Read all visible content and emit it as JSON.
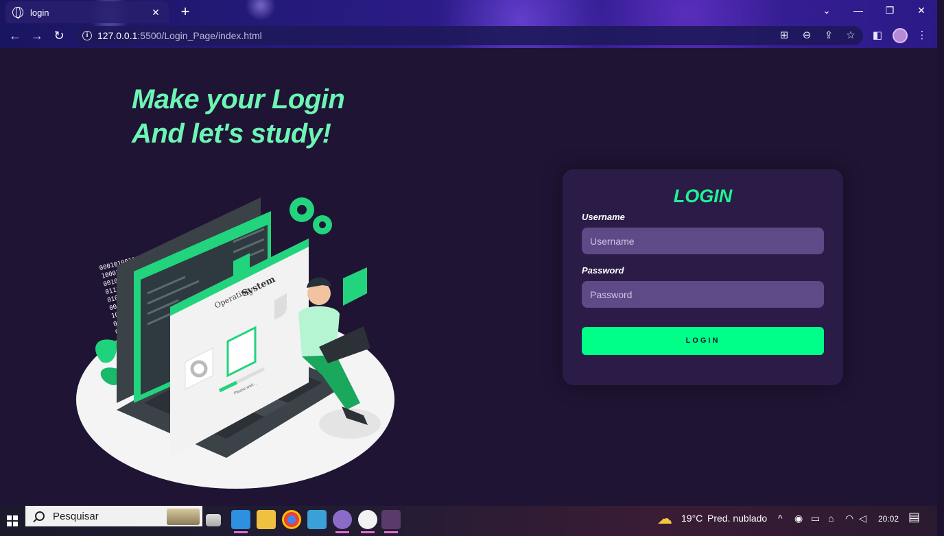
{
  "browser": {
    "tab_title": "login",
    "url_host": "127.0.0.1",
    "url_path": ":5500/Login_Page/index.html"
  },
  "page": {
    "hero_line1": "Make your Login",
    "hero_line2": "And let's study!",
    "illustration": {
      "screen_title_small": "Operating",
      "screen_title_big": "System",
      "progress_text": "Please wait..."
    },
    "login": {
      "title": "LOGIN",
      "username_label": "Username",
      "username_placeholder": "Username",
      "password_label": "Password",
      "password_placeholder": "Password",
      "button_label": "LOGIN"
    }
  },
  "taskbar": {
    "search_placeholder": "Pesquisar",
    "weather_temp": "19°C",
    "weather_desc": "Pred. nublado",
    "time": "20:02"
  },
  "colors": {
    "accent": "#00ff88",
    "page_bg": "#1f1433",
    "card_bg": "#2a1c47",
    "input_bg": "#5d4a86",
    "hero_text": "#6cf5b5"
  }
}
